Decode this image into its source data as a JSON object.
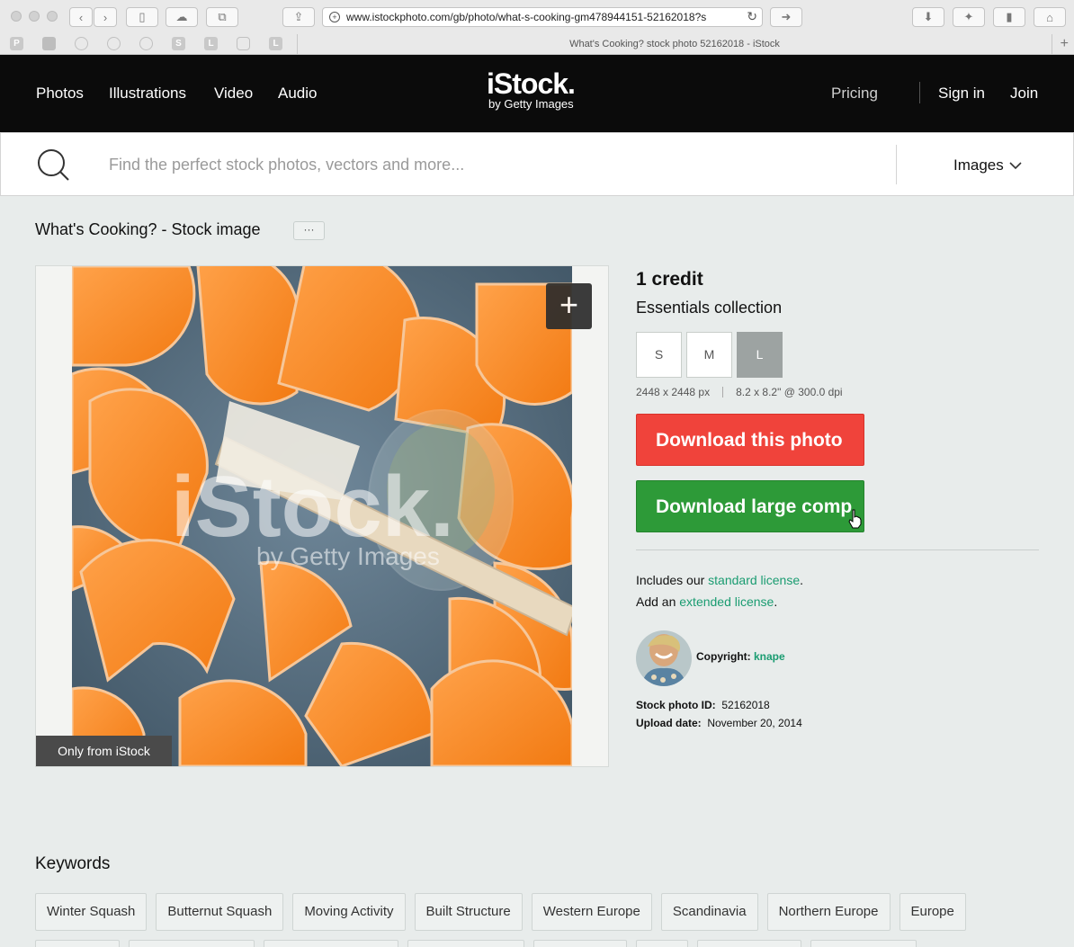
{
  "browser": {
    "url": "www.istockphoto.com/gb/photo/what-s-cooking-gm478944151-52162018?s",
    "tab_title": "What's Cooking? stock photo 52162018 - iStock",
    "bookmark_letters": [
      "P",
      "S",
      "L",
      "L"
    ]
  },
  "nav": {
    "items": [
      {
        "label": "Photos"
      },
      {
        "label": "Illustrations"
      },
      {
        "label": "Video"
      },
      {
        "label": "Audio"
      }
    ],
    "pricing": "Pricing",
    "sign_in": "Sign in",
    "join": "Join"
  },
  "logo": {
    "main": "iStock.",
    "sub": "by Getty Images"
  },
  "search": {
    "placeholder": "Find the perfect stock photos, vectors and more...",
    "value": "",
    "type_label": "Images"
  },
  "page": {
    "title": "What's Cooking? - Stock image",
    "more_label": "···"
  },
  "image": {
    "watermark_main": "iStock.",
    "watermark_sub": "by Getty Images",
    "badge": "Only from iStock",
    "plus_label": "+"
  },
  "info": {
    "credit": "1 credit",
    "collection": "Essentials collection",
    "sizes": [
      "S",
      "M",
      "L"
    ],
    "selected_size": "L",
    "pixel_dims": "2448 x 2448 px",
    "print_dims": "8.2 x 8.2\" @ 300.0 dpi",
    "download_label": "Download this photo",
    "comp_label": "Download large comp",
    "license_prefix": "Includes our ",
    "license_link": "standard license",
    "license_suffix": ".",
    "extended_prefix": "Add an ",
    "extended_link": "extended license",
    "extended_suffix": ".",
    "copyright_label": "Copyright:",
    "copyright_author": "knape",
    "id_label": "Stock photo ID:",
    "id_value": "52162018",
    "date_label": "Upload date:",
    "date_value": "November 20, 2014"
  },
  "keywords": {
    "title": "Keywords",
    "items": [
      "Winter Squash",
      "Butternut Squash",
      "Moving Activity",
      "Built Structure",
      "Western Europe",
      "Scandinavia",
      "Northern Europe",
      "Europe"
    ]
  },
  "colors": {
    "download_red": "#f0433b",
    "comp_green": "#2d9a38",
    "link_green": "#1a9c71",
    "header_black": "#0b0b0b"
  }
}
